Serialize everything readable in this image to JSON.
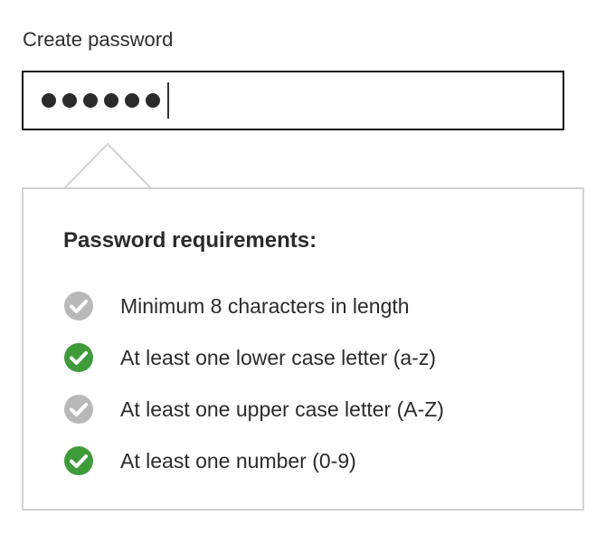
{
  "form": {
    "label": "Create password",
    "password_mask_length": 6
  },
  "requirements": {
    "heading": "Password requirements:",
    "items": [
      {
        "text": "Minimum 8 characters in length",
        "met": false
      },
      {
        "text": "At least one lower case letter (a-z)",
        "met": true
      },
      {
        "text": "At least one upper case letter (A-Z)",
        "met": false
      },
      {
        "text": "At least one number (0-9)",
        "met": true
      }
    ]
  },
  "colors": {
    "met": "#3f9b3a",
    "unmet": "#b9b9b9"
  },
  "icons": {
    "requirement_status": "checkmark-circle-icon"
  }
}
